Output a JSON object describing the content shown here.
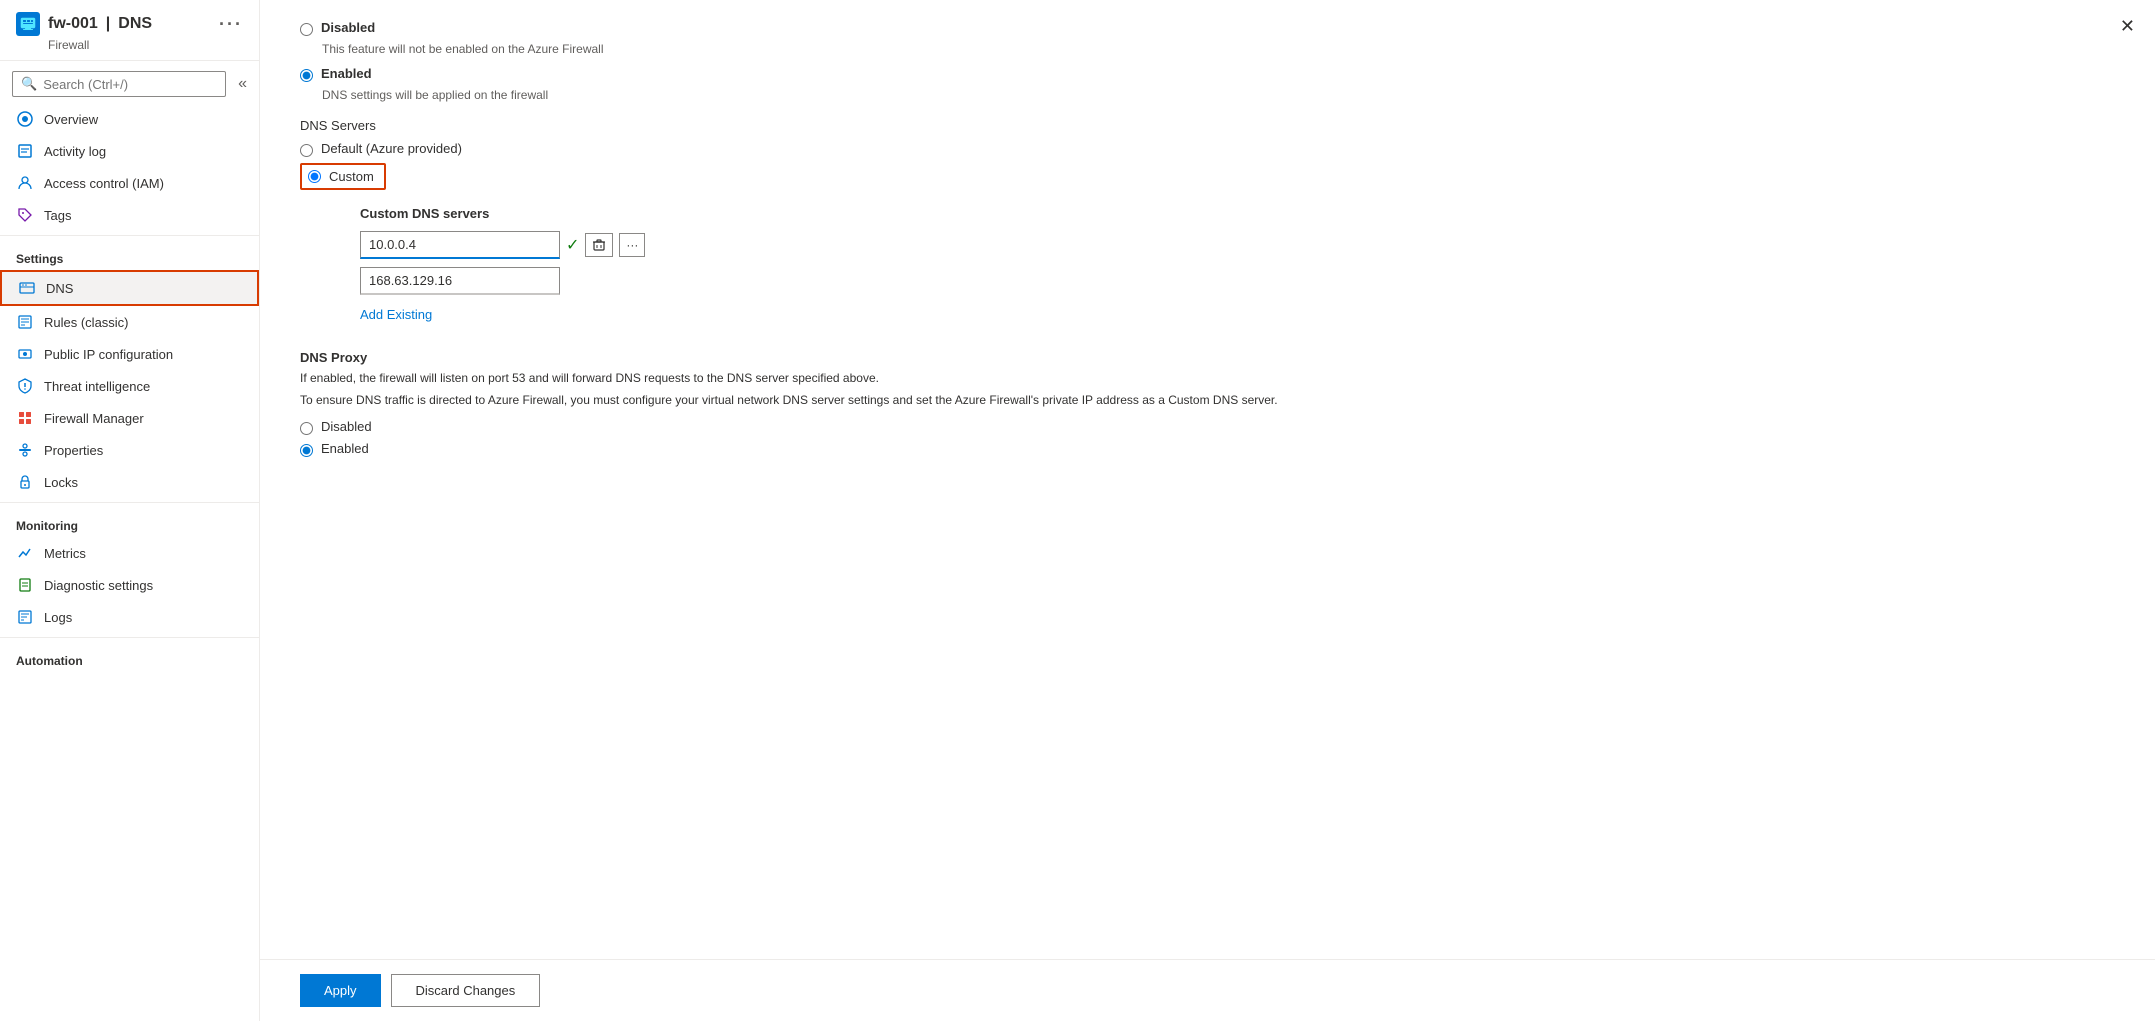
{
  "header": {
    "resource_name": "fw-001",
    "separator": "|",
    "page_title": "DNS",
    "resource_type": "Firewall",
    "more_tooltip": "..."
  },
  "search": {
    "placeholder": "Search (Ctrl+/)"
  },
  "sidebar": {
    "overview_label": "Overview",
    "sections": [
      {
        "label": "",
        "items": [
          {
            "id": "overview",
            "label": "Overview",
            "icon": "overview-icon"
          },
          {
            "id": "activity-log",
            "label": "Activity log",
            "icon": "activity-icon"
          },
          {
            "id": "access-control",
            "label": "Access control (IAM)",
            "icon": "iam-icon"
          },
          {
            "id": "tags",
            "label": "Tags",
            "icon": "tags-icon"
          }
        ]
      },
      {
        "label": "Settings",
        "items": [
          {
            "id": "dns",
            "label": "DNS",
            "icon": "dns-icon",
            "active": true
          },
          {
            "id": "rules-classic",
            "label": "Rules (classic)",
            "icon": "rules-icon"
          },
          {
            "id": "public-ip",
            "label": "Public IP configuration",
            "icon": "pip-icon"
          },
          {
            "id": "threat-intelligence",
            "label": "Threat intelligence",
            "icon": "threat-icon"
          },
          {
            "id": "firewall-manager",
            "label": "Firewall Manager",
            "icon": "fw-manager-icon"
          },
          {
            "id": "properties",
            "label": "Properties",
            "icon": "properties-icon"
          },
          {
            "id": "locks",
            "label": "Locks",
            "icon": "locks-icon"
          }
        ]
      },
      {
        "label": "Monitoring",
        "items": [
          {
            "id": "metrics",
            "label": "Metrics",
            "icon": "metrics-icon"
          },
          {
            "id": "diagnostic-settings",
            "label": "Diagnostic settings",
            "icon": "diagnostic-icon"
          },
          {
            "id": "logs",
            "label": "Logs",
            "icon": "logs-icon"
          }
        ]
      },
      {
        "label": "Automation",
        "items": []
      }
    ]
  },
  "content": {
    "dns_enabled_section": {
      "disabled_label": "Disabled",
      "disabled_desc": "This feature will not be enabled on the Azure Firewall",
      "enabled_label": "Enabled",
      "enabled_desc": "DNS settings will be applied on the firewall"
    },
    "dns_servers_label": "DNS Servers",
    "default_radio_label": "Default (Azure provided)",
    "custom_radio_label": "Custom",
    "custom_dns_servers_title": "Custom DNS servers",
    "dns_entry_1": "10.0.0.4",
    "dns_entry_2": "168.63.129.16",
    "add_existing_label": "Add Existing",
    "dns_proxy_title": "DNS Proxy",
    "dns_proxy_desc1": "If enabled, the firewall will listen on port 53 and will forward DNS requests to the DNS server specified above.",
    "dns_proxy_desc2": "To ensure DNS traffic is directed to Azure Firewall, you must configure your virtual network DNS server settings and set the Azure Firewall's private IP address as a Custom DNS server.",
    "proxy_disabled_label": "Disabled",
    "proxy_enabled_label": "Enabled"
  },
  "footer": {
    "apply_label": "Apply",
    "discard_label": "Discard Changes"
  }
}
